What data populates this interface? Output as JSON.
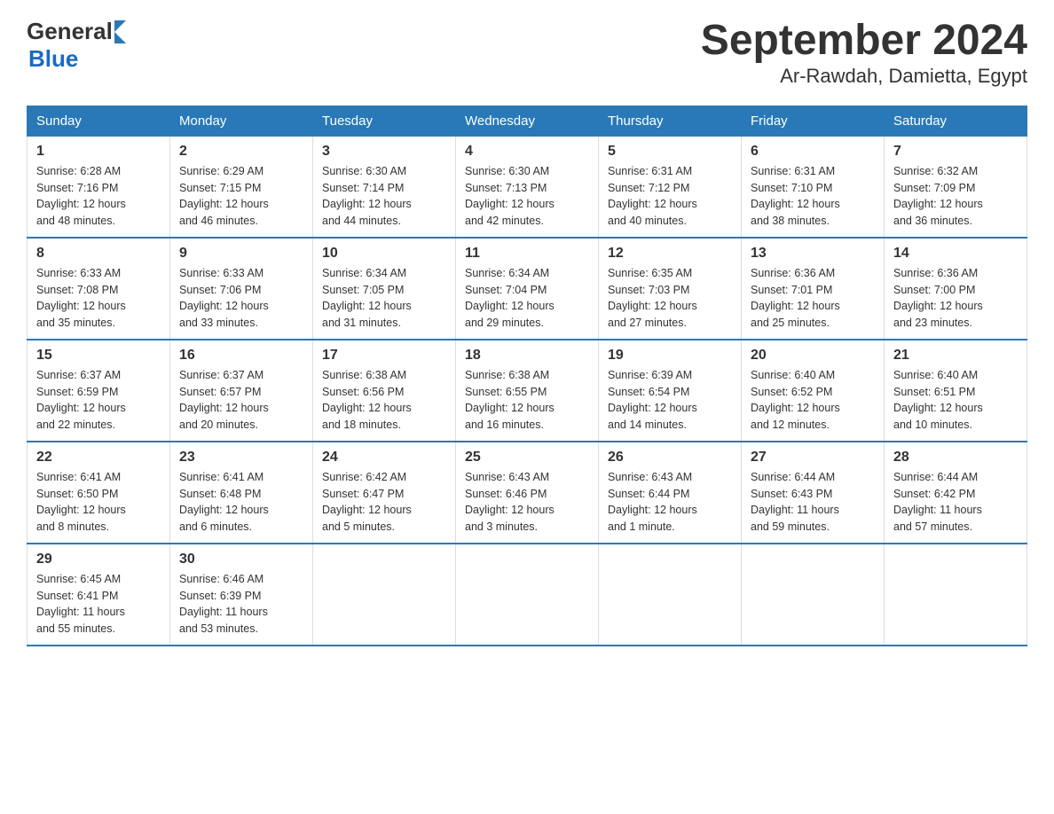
{
  "logo": {
    "general": "General",
    "blue": "Blue"
  },
  "title": "September 2024",
  "subtitle": "Ar-Rawdah, Damietta, Egypt",
  "days_of_week": [
    "Sunday",
    "Monday",
    "Tuesday",
    "Wednesday",
    "Thursday",
    "Friday",
    "Saturday"
  ],
  "weeks": [
    [
      {
        "day": "1",
        "sunrise": "6:28 AM",
        "sunset": "7:16 PM",
        "daylight": "12 hours and 48 minutes."
      },
      {
        "day": "2",
        "sunrise": "6:29 AM",
        "sunset": "7:15 PM",
        "daylight": "12 hours and 46 minutes."
      },
      {
        "day": "3",
        "sunrise": "6:30 AM",
        "sunset": "7:14 PM",
        "daylight": "12 hours and 44 minutes."
      },
      {
        "day": "4",
        "sunrise": "6:30 AM",
        "sunset": "7:13 PM",
        "daylight": "12 hours and 42 minutes."
      },
      {
        "day": "5",
        "sunrise": "6:31 AM",
        "sunset": "7:12 PM",
        "daylight": "12 hours and 40 minutes."
      },
      {
        "day": "6",
        "sunrise": "6:31 AM",
        "sunset": "7:10 PM",
        "daylight": "12 hours and 38 minutes."
      },
      {
        "day": "7",
        "sunrise": "6:32 AM",
        "sunset": "7:09 PM",
        "daylight": "12 hours and 36 minutes."
      }
    ],
    [
      {
        "day": "8",
        "sunrise": "6:33 AM",
        "sunset": "7:08 PM",
        "daylight": "12 hours and 35 minutes."
      },
      {
        "day": "9",
        "sunrise": "6:33 AM",
        "sunset": "7:06 PM",
        "daylight": "12 hours and 33 minutes."
      },
      {
        "day": "10",
        "sunrise": "6:34 AM",
        "sunset": "7:05 PM",
        "daylight": "12 hours and 31 minutes."
      },
      {
        "day": "11",
        "sunrise": "6:34 AM",
        "sunset": "7:04 PM",
        "daylight": "12 hours and 29 minutes."
      },
      {
        "day": "12",
        "sunrise": "6:35 AM",
        "sunset": "7:03 PM",
        "daylight": "12 hours and 27 minutes."
      },
      {
        "day": "13",
        "sunrise": "6:36 AM",
        "sunset": "7:01 PM",
        "daylight": "12 hours and 25 minutes."
      },
      {
        "day": "14",
        "sunrise": "6:36 AM",
        "sunset": "7:00 PM",
        "daylight": "12 hours and 23 minutes."
      }
    ],
    [
      {
        "day": "15",
        "sunrise": "6:37 AM",
        "sunset": "6:59 PM",
        "daylight": "12 hours and 22 minutes."
      },
      {
        "day": "16",
        "sunrise": "6:37 AM",
        "sunset": "6:57 PM",
        "daylight": "12 hours and 20 minutes."
      },
      {
        "day": "17",
        "sunrise": "6:38 AM",
        "sunset": "6:56 PM",
        "daylight": "12 hours and 18 minutes."
      },
      {
        "day": "18",
        "sunrise": "6:38 AM",
        "sunset": "6:55 PM",
        "daylight": "12 hours and 16 minutes."
      },
      {
        "day": "19",
        "sunrise": "6:39 AM",
        "sunset": "6:54 PM",
        "daylight": "12 hours and 14 minutes."
      },
      {
        "day": "20",
        "sunrise": "6:40 AM",
        "sunset": "6:52 PM",
        "daylight": "12 hours and 12 minutes."
      },
      {
        "day": "21",
        "sunrise": "6:40 AM",
        "sunset": "6:51 PM",
        "daylight": "12 hours and 10 minutes."
      }
    ],
    [
      {
        "day": "22",
        "sunrise": "6:41 AM",
        "sunset": "6:50 PM",
        "daylight": "12 hours and 8 minutes."
      },
      {
        "day": "23",
        "sunrise": "6:41 AM",
        "sunset": "6:48 PM",
        "daylight": "12 hours and 6 minutes."
      },
      {
        "day": "24",
        "sunrise": "6:42 AM",
        "sunset": "6:47 PM",
        "daylight": "12 hours and 5 minutes."
      },
      {
        "day": "25",
        "sunrise": "6:43 AM",
        "sunset": "6:46 PM",
        "daylight": "12 hours and 3 minutes."
      },
      {
        "day": "26",
        "sunrise": "6:43 AM",
        "sunset": "6:44 PM",
        "daylight": "12 hours and 1 minute."
      },
      {
        "day": "27",
        "sunrise": "6:44 AM",
        "sunset": "6:43 PM",
        "daylight": "11 hours and 59 minutes."
      },
      {
        "day": "28",
        "sunrise": "6:44 AM",
        "sunset": "6:42 PM",
        "daylight": "11 hours and 57 minutes."
      }
    ],
    [
      {
        "day": "29",
        "sunrise": "6:45 AM",
        "sunset": "6:41 PM",
        "daylight": "11 hours and 55 minutes."
      },
      {
        "day": "30",
        "sunrise": "6:46 AM",
        "sunset": "6:39 PM",
        "daylight": "11 hours and 53 minutes."
      },
      null,
      null,
      null,
      null,
      null
    ]
  ],
  "labels": {
    "sunrise": "Sunrise:",
    "sunset": "Sunset:",
    "daylight": "Daylight:"
  }
}
